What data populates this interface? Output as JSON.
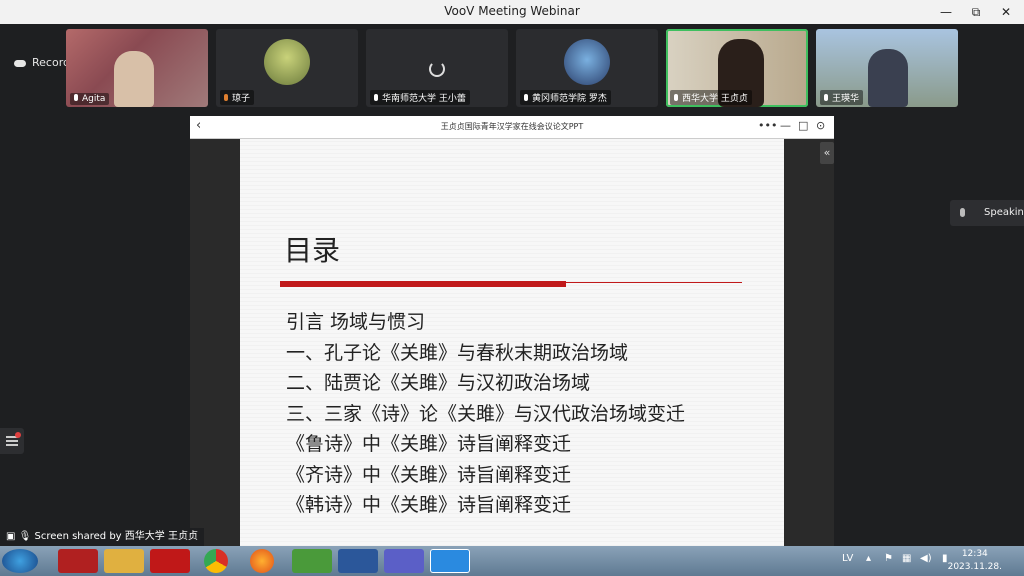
{
  "window": {
    "title": "VooV Meeting Webinar",
    "controls": [
      "—",
      "⧉",
      "✕"
    ]
  },
  "recording": {
    "label": "Recording"
  },
  "participants": [
    {
      "name": "Agita"
    },
    {
      "name": "琼子"
    },
    {
      "name": "华南师范大学 王小蕾"
    },
    {
      "name": "黄冈师范学院 罗杰"
    },
    {
      "name": "西华大学 王贞贞"
    },
    {
      "name": "王瑛华"
    }
  ],
  "slide_window": {
    "doc_title": "王贞贞国际青年汉学家在线会议论文PPT",
    "controls": [
      "•••",
      "—",
      "□",
      "⊙"
    ]
  },
  "slide": {
    "heading": "目录",
    "items": [
      "引言 场域与惯习",
      "一、孔子论《关雎》与春秋末期政治场域",
      "二、陆贾论《关雎》与汉初政治场域",
      "三、三家《诗》论《关雎》与汉代政治场域变迁",
      "《鲁诗》中《关雎》诗旨阐释变迁",
      "《齐诗》中《关雎》诗旨阐释变迁",
      "《韩诗》中《关雎》诗旨阐释变迁"
    ],
    "accent_color": "#c0191a"
  },
  "speaking": {
    "label": "Speaking"
  },
  "share_status": {
    "label": "Screen shared by 西华大学 王贞贞"
  },
  "taskbar": {
    "language": "LV",
    "time": "12:34",
    "date": "2023.11.28."
  }
}
